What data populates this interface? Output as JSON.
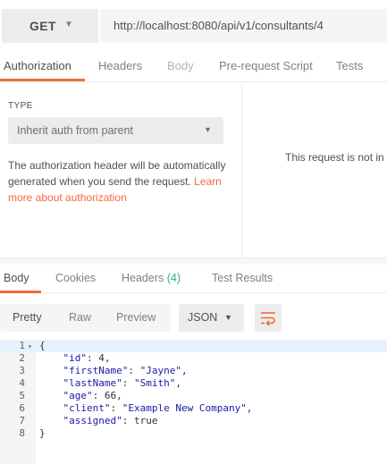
{
  "request": {
    "method": "GET",
    "url": "http://localhost:8080/api/v1/consultants/4"
  },
  "request_tabs": [
    {
      "label": "Authorization",
      "state": "active"
    },
    {
      "label": "Headers",
      "state": "normal"
    },
    {
      "label": "Body",
      "state": "disabled"
    },
    {
      "label": "Pre-request Script",
      "state": "normal"
    },
    {
      "label": "Tests",
      "state": "normal"
    }
  ],
  "auth": {
    "type_label": "TYPE",
    "type_value": "Inherit auth from parent",
    "description": "The authorization header will be automatically generated when you send the request. ",
    "link": "Learn more about authorization",
    "right_message": "This request is not in"
  },
  "response_tabs": [
    {
      "label": "Body",
      "state": "active"
    },
    {
      "label": "Cookies",
      "state": "normal"
    },
    {
      "label": "Headers",
      "count": "(4)",
      "state": "normal"
    },
    {
      "label": "Test Results",
      "state": "normal"
    }
  ],
  "view": {
    "modes": [
      "Pretty",
      "Raw",
      "Preview"
    ],
    "active_mode": "Pretty",
    "format": "JSON",
    "wrap_icon": "wrap-lines-icon"
  },
  "code_lines": [
    {
      "n": "1",
      "text": "{"
    },
    {
      "n": "2",
      "key": "\"id\"",
      "value": "4,"
    },
    {
      "n": "3",
      "key": "\"firstName\"",
      "value": "\"Jayne\","
    },
    {
      "n": "4",
      "key": "\"lastName\"",
      "value": "\"Smith\","
    },
    {
      "n": "5",
      "key": "\"age\"",
      "value": "66,"
    },
    {
      "n": "6",
      "key": "\"client\"",
      "value": "\"Example New Company\","
    },
    {
      "n": "7",
      "key": "\"assigned\"",
      "value": "true"
    },
    {
      "n": "8",
      "text": "}"
    }
  ],
  "colors": {
    "accent": "#f26b3a",
    "count": "#26b47f",
    "code_token": "#1a1aa6"
  }
}
